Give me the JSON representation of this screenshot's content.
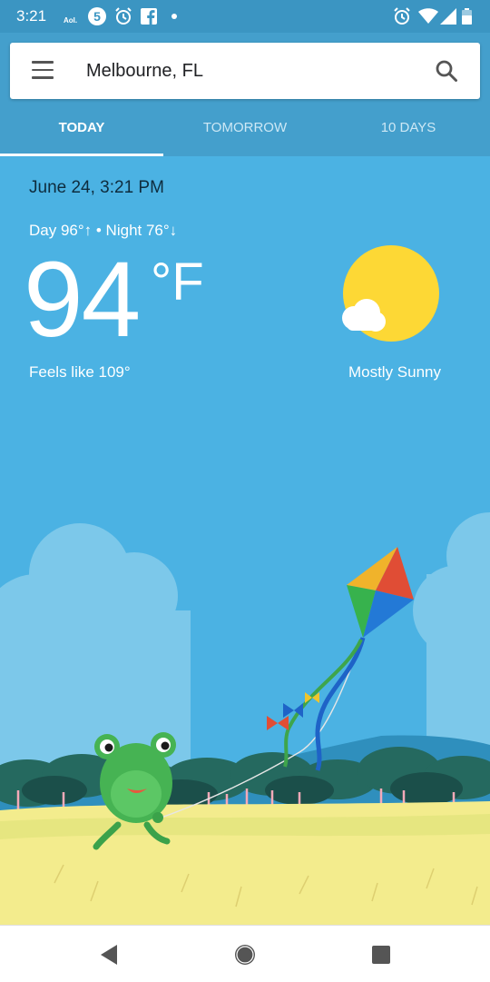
{
  "status_bar": {
    "time": "3:21",
    "aol_text": "Aol.",
    "badge_number": "5",
    "icons": [
      "aol-icon",
      "badge-5-icon",
      "alarm-icon",
      "facebook-icon",
      "dot-icon",
      "alarm-icon",
      "wifi-icon",
      "signal-icon",
      "battery-icon"
    ]
  },
  "search": {
    "location": "Melbourne, FL"
  },
  "tabs": [
    {
      "label": "TODAY",
      "active": true
    },
    {
      "label": "TOMORROW",
      "active": false
    },
    {
      "label": "10 DAYS",
      "active": false
    }
  ],
  "weather": {
    "date_time": "June 24, 3:21 PM",
    "day_night": "Day 96°↑ • Night 76°↓",
    "temperature": "94",
    "unit": "°F",
    "feels_like": "Feels like 109°",
    "condition": "Mostly Sunny"
  },
  "colors": {
    "sky": "#4bb2e3",
    "header": "#449fcc",
    "status_bar": "#3b95c2",
    "sun": "#fdd835",
    "grass": "#f3ec8d"
  },
  "navigation": [
    "back-icon",
    "home-icon",
    "recents-icon"
  ]
}
